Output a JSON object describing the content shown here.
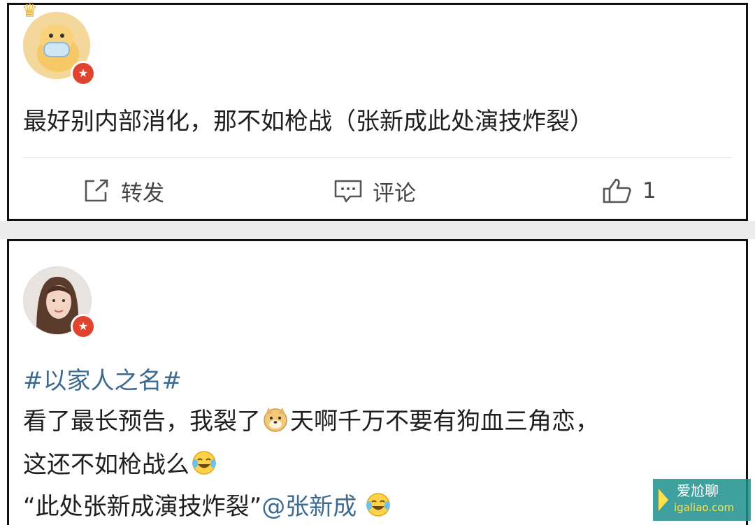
{
  "post1": {
    "text": "最好别内部消化，那不如枪战（张新成此处演技炸裂）",
    "actions": {
      "repost_label": "转发",
      "comment_label": "评论",
      "like_count": "1"
    }
  },
  "post2": {
    "hashtag": "#以家人之名#",
    "line1_a": "看了最长预告，我裂了",
    "line1_b": "天啊千万不要有狗血三角恋，",
    "line2": "这还不如枪战么",
    "line3_quote": "“此处张新成演技炸裂”",
    "line3_mention": "@张新成"
  },
  "icons": {
    "verified_badge": "red-star-badge",
    "crown": "crown-icon",
    "emoji_doge": "doge-emoji",
    "emoji_laugh": "laugh-cry-emoji"
  },
  "watermark": {
    "brand": "爱尬聊",
    "url": "igaliao.com"
  },
  "colors": {
    "link": "#3d6a8e",
    "badge": "#e0442f",
    "separator": "#ececec"
  }
}
